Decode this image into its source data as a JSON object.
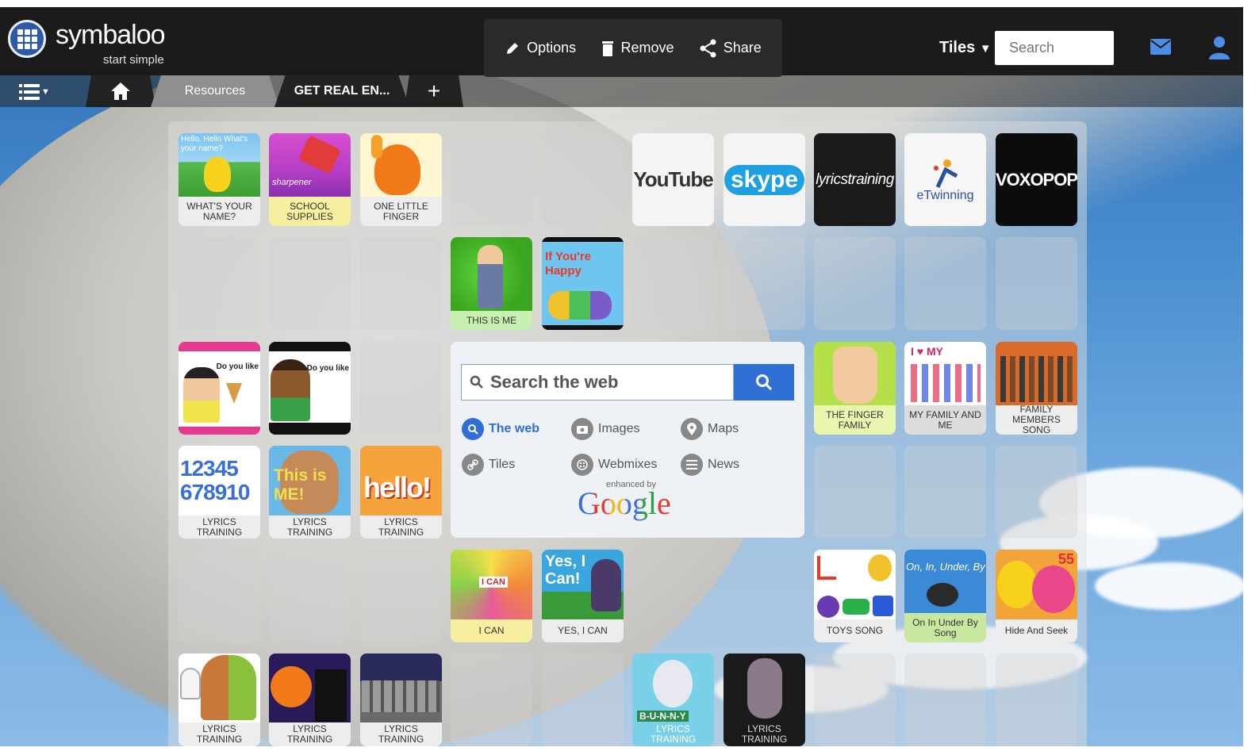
{
  "app": {
    "logo_text": "symbaloo",
    "tagline": "start simple"
  },
  "toolbar": {
    "options_label": "Options",
    "remove_label": "Remove",
    "share_label": "Share",
    "tiles_label": "Tiles",
    "search_placeholder": "Search"
  },
  "tabs": {
    "resources": "Resources",
    "getreal": "GET REAL EN...",
    "add": "+"
  },
  "tiles": {
    "t01": {
      "caption": "WHAT'S YOUR NAME?",
      "img_text": "Hello, Hello What's your name?"
    },
    "t02": {
      "caption": "SCHOOL SUPPLIES",
      "img_text": "sharpener"
    },
    "t03": {
      "caption": "ONE LITTLE FINGER"
    },
    "t06": {
      "logo": "YouTube"
    },
    "t07": {
      "logo": "skype"
    },
    "t08": {
      "logo": "lyricstraining"
    },
    "t09": {
      "logo": "eTwinning"
    },
    "t10": {
      "logo": "VOXOPOP"
    },
    "t14": {
      "caption": "THIS IS ME"
    },
    "t15": {
      "img_text": "If You're Happy"
    },
    "t21": {
      "img_text": "Do you like"
    },
    "t22": {
      "img_text": "Do you like"
    },
    "t24": {
      "caption": "THE FINGER FAMILY"
    },
    "t25": {
      "caption": "MY FAMILY AND ME",
      "img_text": "I ♥ MY"
    },
    "t26": {
      "caption": "FAMILY MEMBERS SONG"
    },
    "t27": {
      "caption": "LYRICS TRAINING",
      "img_text": "12345 678910"
    },
    "t28": {
      "caption": "LYRICS TRAINING",
      "img_text": "This is ME!"
    },
    "t29": {
      "caption": "LYRICS TRAINING",
      "img_text": "hello!"
    },
    "t33": {
      "caption": "I CAN",
      "img_text": "I CAN"
    },
    "t34": {
      "caption": "YES, I CAN",
      "img_text": "Yes, I Can!"
    },
    "t37": {
      "caption": "TOYS SONG"
    },
    "t38": {
      "caption": "On In Under By Song",
      "img_text": "On, In, Under, By"
    },
    "t39": {
      "caption": "Hide And Seek",
      "img_text": "55"
    },
    "t40": {
      "caption": "LYRICS TRAINING"
    },
    "t41": {
      "caption": "LYRICS TRAINING"
    },
    "t42": {
      "caption": "LYRICS TRAINING"
    },
    "t45": {
      "caption": "LYRICS TRAINING",
      "img_text": "B-U-N-N-Y"
    },
    "t46": {
      "caption": "LYRICS TRAINING"
    }
  },
  "widget": {
    "placeholder": "Search the web",
    "options": [
      "The web",
      "Images",
      "Maps",
      "Tiles",
      "Webmixes",
      "News"
    ],
    "enhanced": "enhanced by",
    "google": "Google"
  },
  "colors": {
    "accent": "#2f6fd6",
    "topbar": "#1b1b1b",
    "logo_blue": "#2d5aa6"
  }
}
